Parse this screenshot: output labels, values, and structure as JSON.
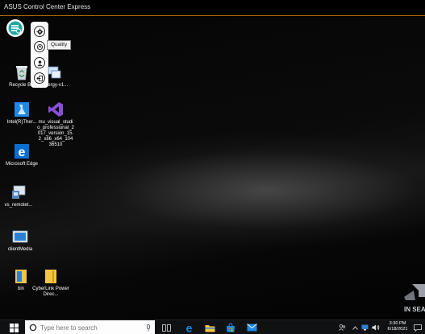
{
  "window": {
    "title": "ASUS Control Center Express"
  },
  "controller": {
    "main_icon": "remote-control-icon",
    "buttons": [
      {
        "icon": "settings-gear-icon"
      },
      {
        "icon": "quality-icon"
      },
      {
        "icon": "user-icon"
      },
      {
        "icon": "exit-icon"
      }
    ],
    "tooltip": "Quality"
  },
  "desktop": {
    "icons": [
      {
        "label": "Recycle Bin",
        "icon": "recycle-bin-icon"
      },
      {
        "label": "synergy-v1...",
        "icon": "synergy-icon"
      },
      {
        "label": "Intel(R)Ther...",
        "icon": "intel-icon"
      },
      {
        "label": "mu_visual_studio_professional_2017_version_15.2_x86_x64_10436510",
        "icon": "visual-studio-icon"
      },
      {
        "label": "Microsoft Edge",
        "icon": "edge-icon"
      },
      {
        "label": "vs_remotet...",
        "icon": "vs-remote-icon"
      },
      {
        "label": "clientMedia",
        "icon": "client-media-icon"
      },
      {
        "label": "bin",
        "icon": "folder-icon"
      },
      {
        "label": "CyberLink PowerDirec...",
        "icon": "folder-icon"
      }
    ],
    "logo_text": "IN SEAR"
  },
  "taskbar": {
    "search_placeholder": "Type here to search",
    "time": "3:30 PM",
    "date": "6/18/2021",
    "colors": {
      "accent": "#0078d7",
      "folder": "#f4c542",
      "store": "#1e88e5"
    }
  }
}
